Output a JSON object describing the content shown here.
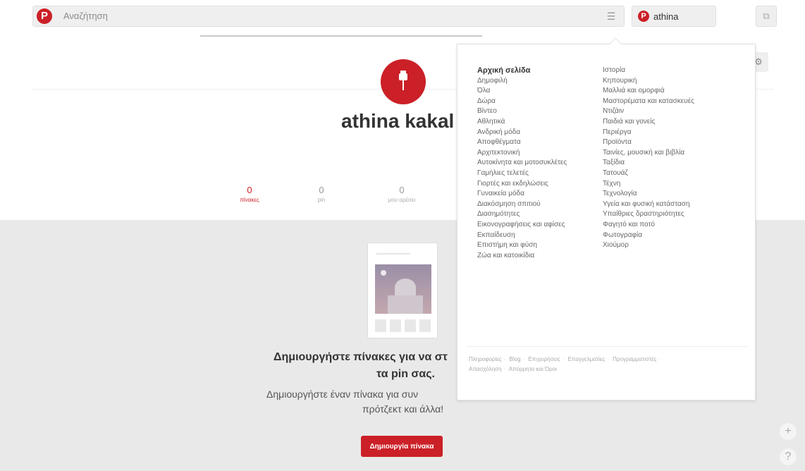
{
  "header": {
    "logo_letter": "P",
    "search_placeholder": "Αναζήτηση",
    "menu_icon": "☰",
    "user_name": "athina",
    "user_initial": "P",
    "messages_icon": "⧉"
  },
  "profile": {
    "name": "athina kakal",
    "settings_icon": "⚙",
    "stats": [
      {
        "num": "0",
        "label": "πίνακες"
      },
      {
        "num": "0",
        "label": "pin"
      },
      {
        "num": "0",
        "label": "μου αρέσει"
      }
    ]
  },
  "cta": {
    "title_line1": "Δημιουργήστε πίνακες για να στ",
    "title_line2": "τα pin σας.",
    "sub_line1": "Δημιουργήστε έναν πίνακα για συν",
    "sub_line2": "πρότζεκτ και άλλα!",
    "button": "Δημιουργία πίνακα"
  },
  "side": {
    "plus": "+",
    "help": "?"
  },
  "dropdown": {
    "col1": [
      "Αρχική σελίδα",
      "Δημοφιλή",
      "Όλα",
      "Δώρα",
      "Βίντεο",
      "Αθλητικά",
      "Ανδρική μόδα",
      "Αποφθέγματα",
      "Αρχιτεκτονική",
      "Αυτοκίνητα και μοτοσυκλέτες",
      "Γαμήλιες τελετές",
      "Γιορτές και εκδηλώσεις",
      "Γυναικεία μόδα",
      "Διακόσμηση σπιτιού",
      "Διασημότητες",
      "Εικονογραφήσεις και αφίσες",
      "Εκπαίδευση",
      "Επιστήμη και φύση",
      "Ζώα και κατοικίδια"
    ],
    "col2": [
      "Ιστορία",
      "Κηπουρική",
      "Μαλλιά και ομορφιά",
      "Μαστορέματα και κατασκευές",
      "Ντιζάιν",
      "Παιδιά και γονείς",
      "Περιέργα",
      "Προϊόντα",
      "Ταινίες, μουσική και βιβλία",
      "Ταξίδια",
      "Τατουάζ",
      "Τέχνη",
      "Τεχνολογία",
      "Υγεία και φυσική κατάσταση",
      "Υπαίθριες δραστηριότητες",
      "Φαγητό και ποτό",
      "Φωτογραφία",
      "Χιούμορ"
    ],
    "footer": [
      "Πληροφορίες",
      "Blog",
      "Επιχειρήσεις",
      "Επαγγελματίες",
      "Προγραμματιστές",
      "Απασχόληση",
      "Απόρρητο και Όροι"
    ]
  }
}
